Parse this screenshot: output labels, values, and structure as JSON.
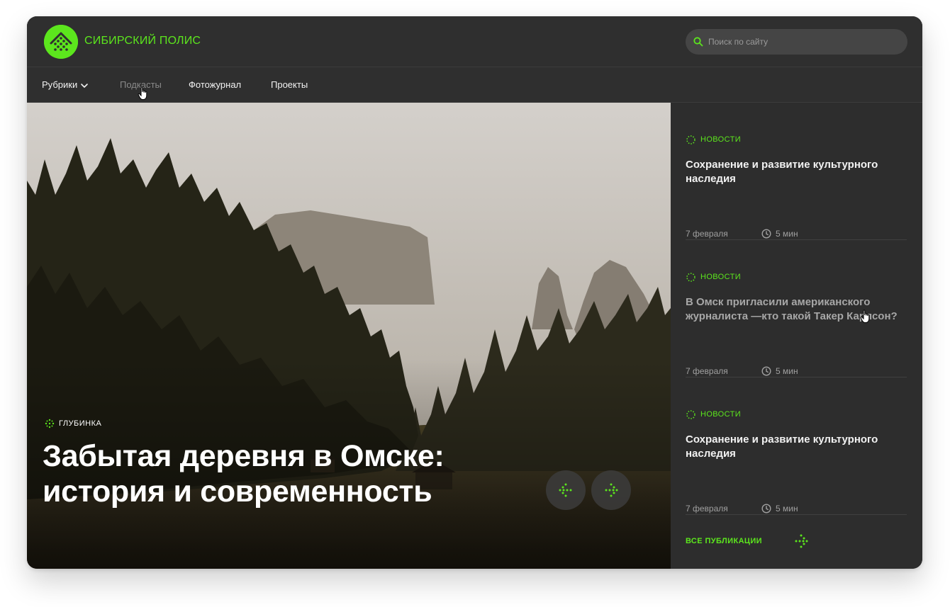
{
  "header": {
    "brand": "СИБИРСКИЙ ПОЛИС",
    "search_placeholder": "Поиск по сайту"
  },
  "nav": {
    "items": [
      {
        "label": "Рубрики"
      },
      {
        "label": "Подкасты"
      },
      {
        "label": "Фотожурнал"
      },
      {
        "label": "Проекты"
      }
    ]
  },
  "hero": {
    "tag": "ГЛУБИНКА",
    "title": "Забытая деревня в Омске: история и современность"
  },
  "sidebar": {
    "news": [
      {
        "tag": "НОВОСТИ",
        "title": "Сохранение и развитие культурного наследия",
        "date": "7 февраля",
        "read_time": "5 мин"
      },
      {
        "tag": "НОВОСТИ",
        "title": "В Омск пригласили американского журналиста —кто такой Такер Карлсон?",
        "date": "7 февраля",
        "read_time": "5 мин"
      },
      {
        "tag": "НОВОСТИ",
        "title": "Сохранение и развитие культурного наследия",
        "date": "7 февраля",
        "read_time": "5 мин"
      }
    ],
    "all_publications": "ВСЕ ПУБЛИКАЦИИ"
  },
  "colors": {
    "accent": "#5ce61d",
    "background": "#2d2d2d",
    "text": "#f2f2f2",
    "muted": "#8a8a8a"
  },
  "icons": [
    "logo-icon",
    "search-icon",
    "chevron-down-icon",
    "cursor-hand-icon",
    "dotted-circle-icon",
    "clock-icon",
    "arrow-left-icon",
    "arrow-right-icon",
    "sparkle-icon"
  ]
}
